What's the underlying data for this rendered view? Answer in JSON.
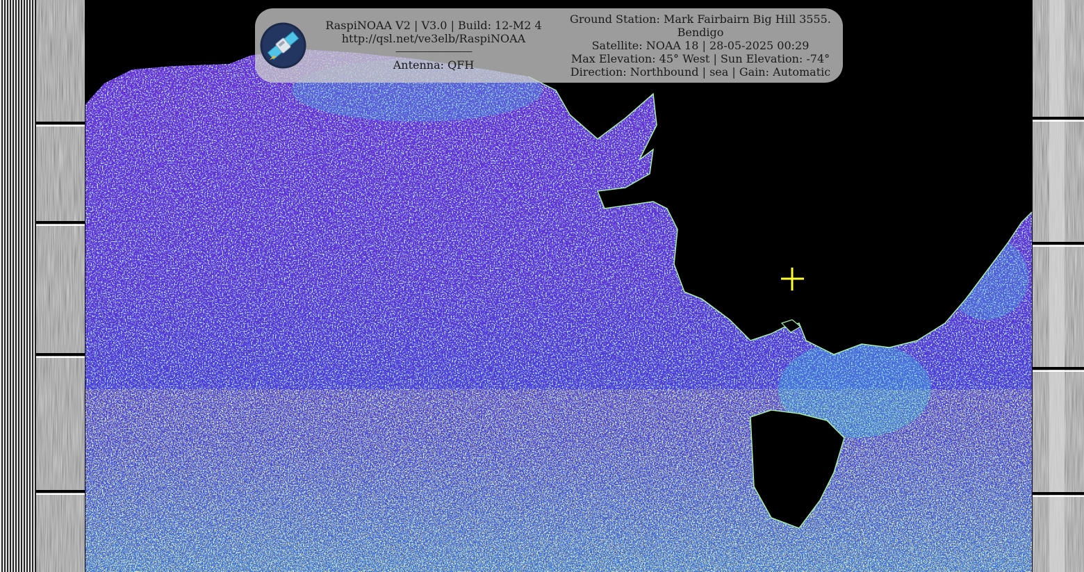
{
  "header": {
    "app_title": "RaspiNOAA V2 | V3.0 | Build: 12-M2 4",
    "url": "http://qsl.net/ve3elb/RaspiNOAA",
    "separator": "------------------------------------",
    "antenna": "Antenna: QFH",
    "ground_station": "Ground Station: Mark Fairbairn Big Hill 3555.",
    "ground_station_city": "Bendigo",
    "satellite": "Satellite: NOAA 18 | 28-05-2025 00:29",
    "elevation": "Max Elevation: 45° West | Sun Elevation: -74°",
    "direction": "Direction: Northbound | sea | Gain: Automatic",
    "logo_icon": "satellite-icon"
  },
  "colors": {
    "background": "#000000",
    "marker": "#ffff33",
    "ocean_low": "#7a2be0",
    "ocean_mid": "#3a3ae0",
    "ocean_high": "#3ad6e0",
    "ocean_noise": "#f0d040",
    "coastline": "#a8f0a8"
  },
  "image": {
    "location_marker_icon": "crosshair-icon"
  }
}
